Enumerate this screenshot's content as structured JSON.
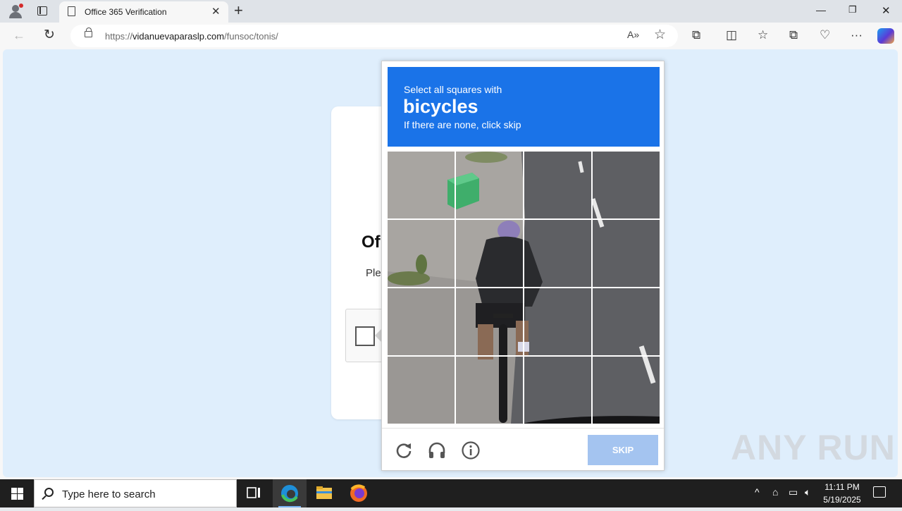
{
  "browser": {
    "tab_title": "Office 365 Verification",
    "url_host": "vidanuevaparaslp.com",
    "url_prefix": "https://",
    "url_path": "/funsoc/tonis/"
  },
  "page": {
    "title_partial": "Of",
    "subtitle_partial": "Ple"
  },
  "captcha": {
    "instruction": "Select all squares with",
    "target": "bicycles",
    "hint": "If there are none, click skip",
    "skip_label": "SKIP",
    "grid_rows": 4,
    "grid_cols": 4
  },
  "watermark": "ANY RUN",
  "taskbar": {
    "search_placeholder": "Type here to search",
    "time": "11:11 PM",
    "date": "5/19/2025"
  },
  "colors": {
    "captcha_header": "#1a73e8",
    "skip_button": "#a4c4f0",
    "page_background": "#dfeefc"
  }
}
